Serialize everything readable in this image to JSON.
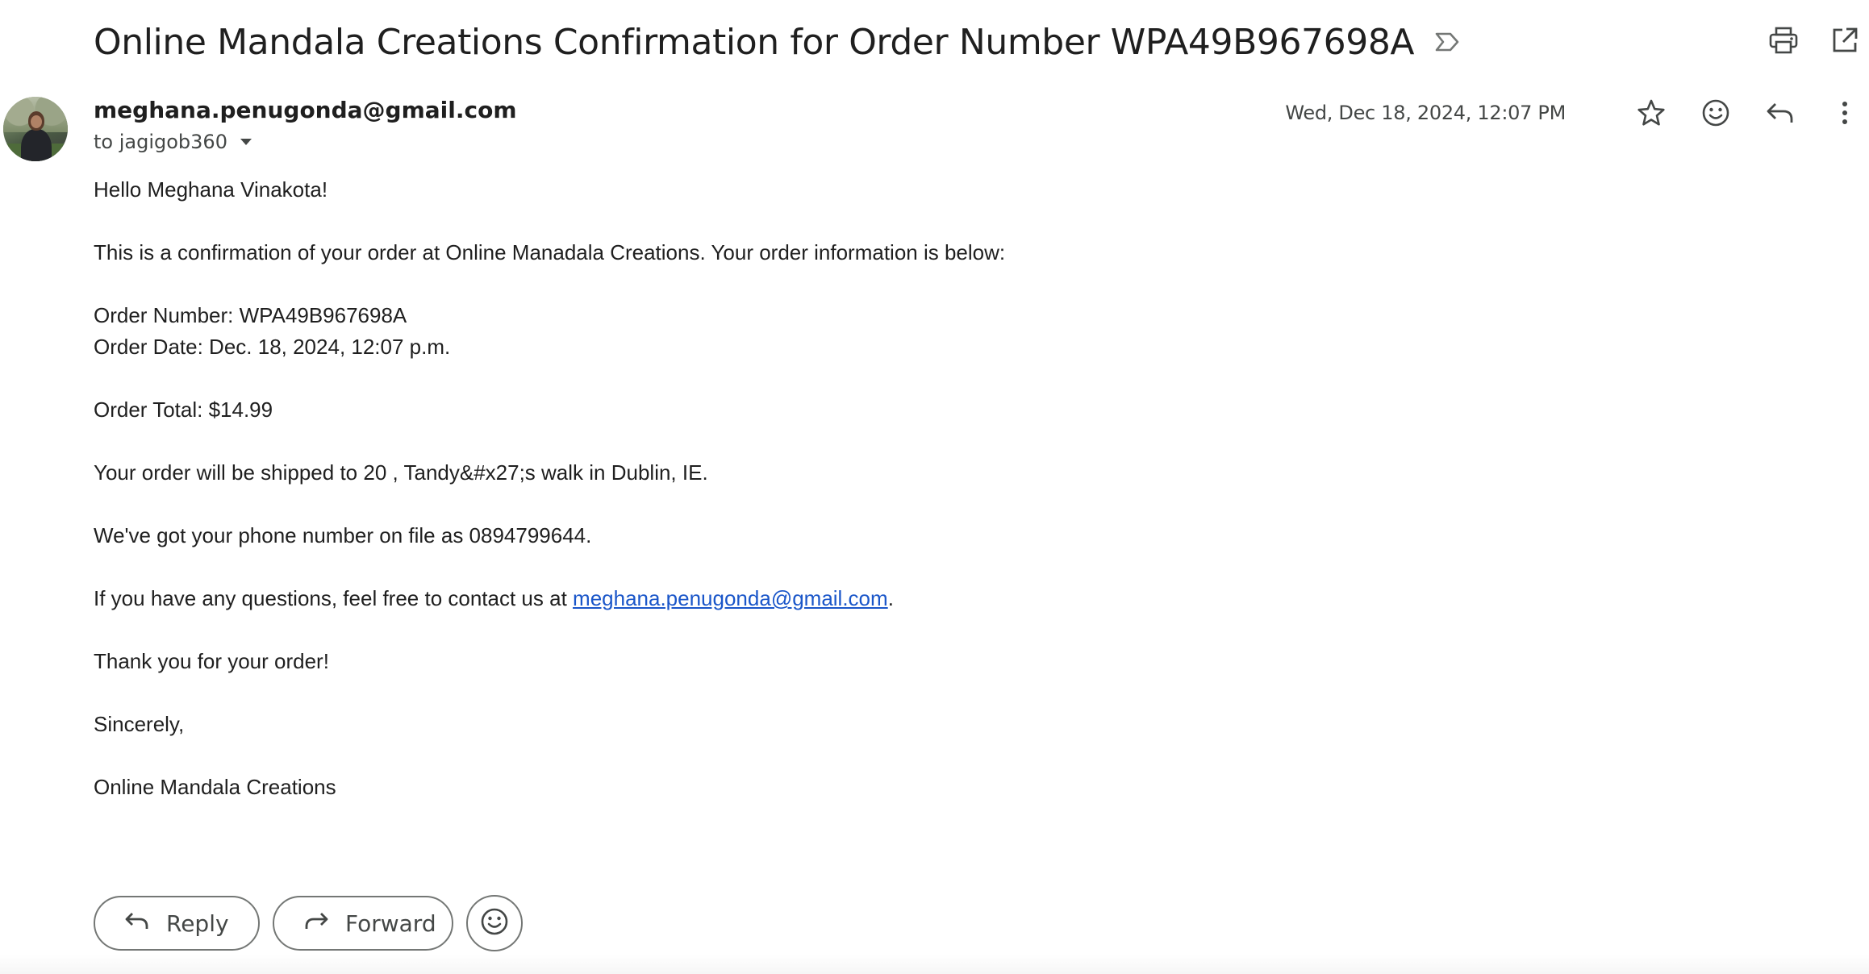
{
  "subject": "Online Mandala Creations Confirmation for Order Number WPA49B967698A",
  "toolbar": {
    "label_icon": "label-arrow-icon",
    "print_icon": "print-icon",
    "new_window_icon": "open-in-new-window-icon"
  },
  "sender": {
    "email": "meghana.penugonda@gmail.com",
    "to_line": "to jagigob360",
    "timestamp": "Wed, Dec 18, 2024, 12:07 PM"
  },
  "meta_icons": [
    "star-icon",
    "emoji-icon",
    "reply-icon",
    "more-vert-icon"
  ],
  "body": {
    "greeting": "Hello Meghana Vinakota!",
    "intro": "This is a confirmation of your order at Online Manadala Creations. Your order information is below:",
    "order_number": "Order Number: WPA49B967698A",
    "order_date": "Order Date: Dec. 18, 2024, 12:07 p.m.",
    "order_total": "Order Total: $14.99",
    "shipping": "Your order will be shipped to 20 , Tandy&#x27;s walk in Dublin, IE.",
    "phone": "We've got your phone number on file as 0894799644.",
    "contact_prefix": "If you have any questions, feel free to contact us at ",
    "contact_email": "meghana.penugonda@gmail.com",
    "contact_suffix": ".",
    "thanks": "Thank you for your order!",
    "signoff": "Sincerely,",
    "signature": "Online Mandala Creations"
  },
  "actions": {
    "reply_label": "Reply",
    "forward_label": "Forward"
  }
}
